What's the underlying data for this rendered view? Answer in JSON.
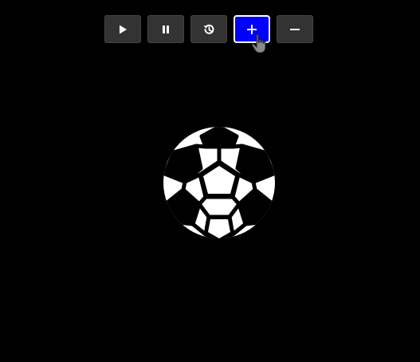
{
  "toolbar": {
    "buttons": [
      {
        "name": "play-button",
        "icon": "play-icon"
      },
      {
        "name": "pause-button",
        "icon": "pause-icon"
      },
      {
        "name": "reset-button",
        "icon": "history-icon"
      },
      {
        "name": "zoom-in-button",
        "icon": "plus-icon",
        "state": "active-hover"
      },
      {
        "name": "zoom-out-button",
        "icon": "minus-icon"
      }
    ]
  },
  "canvas": {
    "object": "soccer-ball-icon",
    "background": "#000000"
  },
  "colors": {
    "accent": "#0000ff",
    "button_bg": "#333333",
    "icon": "#ffffff"
  }
}
